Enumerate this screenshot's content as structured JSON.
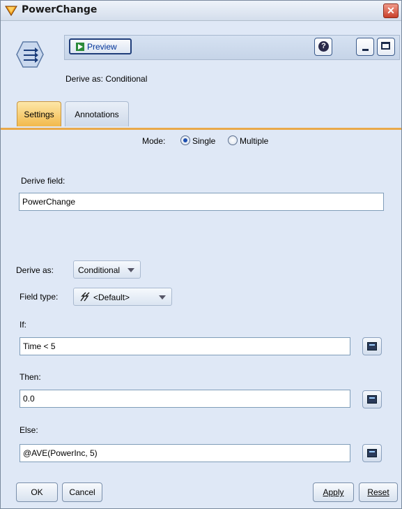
{
  "window": {
    "title": "PowerChange",
    "close_glyph": "✕"
  },
  "header": {
    "preview_label": "Preview",
    "help_glyph": "?",
    "derive_as_text": "Derive as: Conditional"
  },
  "tabs": [
    {
      "label": "Settings",
      "active": true
    },
    {
      "label": "Annotations",
      "active": false
    }
  ],
  "settings": {
    "mode_label": "Mode:",
    "mode_options": [
      {
        "label": "Single",
        "selected": true
      },
      {
        "label": "Multiple",
        "selected": false
      }
    ],
    "derive_field_label": "Derive field:",
    "derive_field_value": "PowerChange",
    "derive_as_label": "Derive as:",
    "derive_as_value": "Conditional",
    "field_type_label": "Field type:",
    "field_type_value": "<Default>",
    "if_label": "If:",
    "if_value": "Time < 5",
    "then_label": "Then:",
    "then_value": "0.0",
    "else_label": "Else:",
    "else_value": "@AVE(PowerInc, 5)"
  },
  "footer": {
    "ok_label": "OK",
    "cancel_label": "Cancel",
    "apply_label": "Apply",
    "reset_label": "Reset"
  },
  "colors": {
    "panel_bg": "#dfe8f6",
    "active_tab": "#f2b94c",
    "tab_underline": "#e9a94a",
    "link_blue": "#003399"
  },
  "icons": {
    "title": "derive-node-diamond-icon",
    "node": "derive-node-icon",
    "preview": "play-table-icon",
    "help": "help-icon",
    "minimize": "minimize-icon",
    "maximize": "maximize-icon",
    "field_type": "lightning-icon",
    "expression_builder": "calculator-icon"
  }
}
